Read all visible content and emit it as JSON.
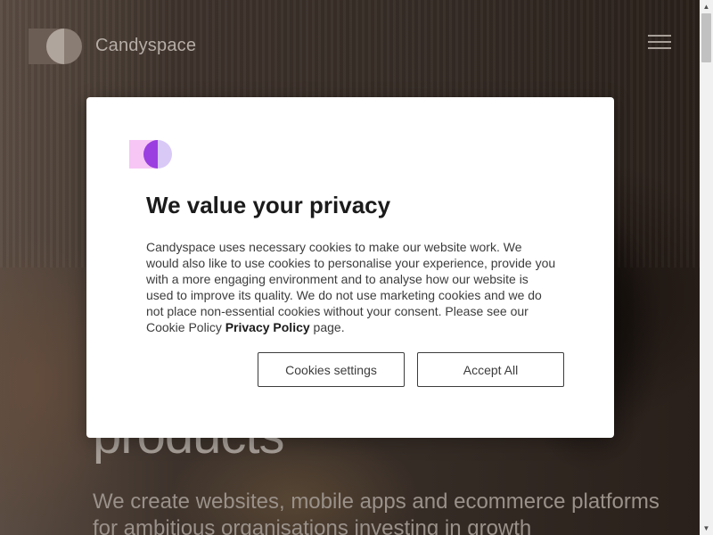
{
  "header": {
    "brand": "Candyspace",
    "logo_icon": "candyspace-logo-icon",
    "menu_icon": "hamburger-menu-icon"
  },
  "hero": {
    "heading_partial": "products",
    "subheading": "We create websites, mobile apps and ecommerce platforms for ambitious organisations investing in growth"
  },
  "cookie_modal": {
    "logo_icon": "candyspace-logo-icon",
    "title": "We value your privacy",
    "body_text": "Candyspace uses necessary cookies to make our website work. We would also like to use cookies to personalise your experience, provide you with a more engaging environment and to analyse how our website is used to improve its quality. We do not use marketing cookies and we do not place non-essential cookies without your consent. Please see our Cookie Policy ",
    "privacy_link": "Privacy Policy",
    "body_suffix": " page.",
    "settings_button": "Cookies settings",
    "accept_button": "Accept All",
    "colors": {
      "logo_square": "#f7c6f5",
      "logo_circle": "#d8c9f7",
      "logo_half": "#9b3fe0"
    }
  },
  "scrollbar": {
    "up_arrow": "▲",
    "down_arrow": "▼"
  }
}
